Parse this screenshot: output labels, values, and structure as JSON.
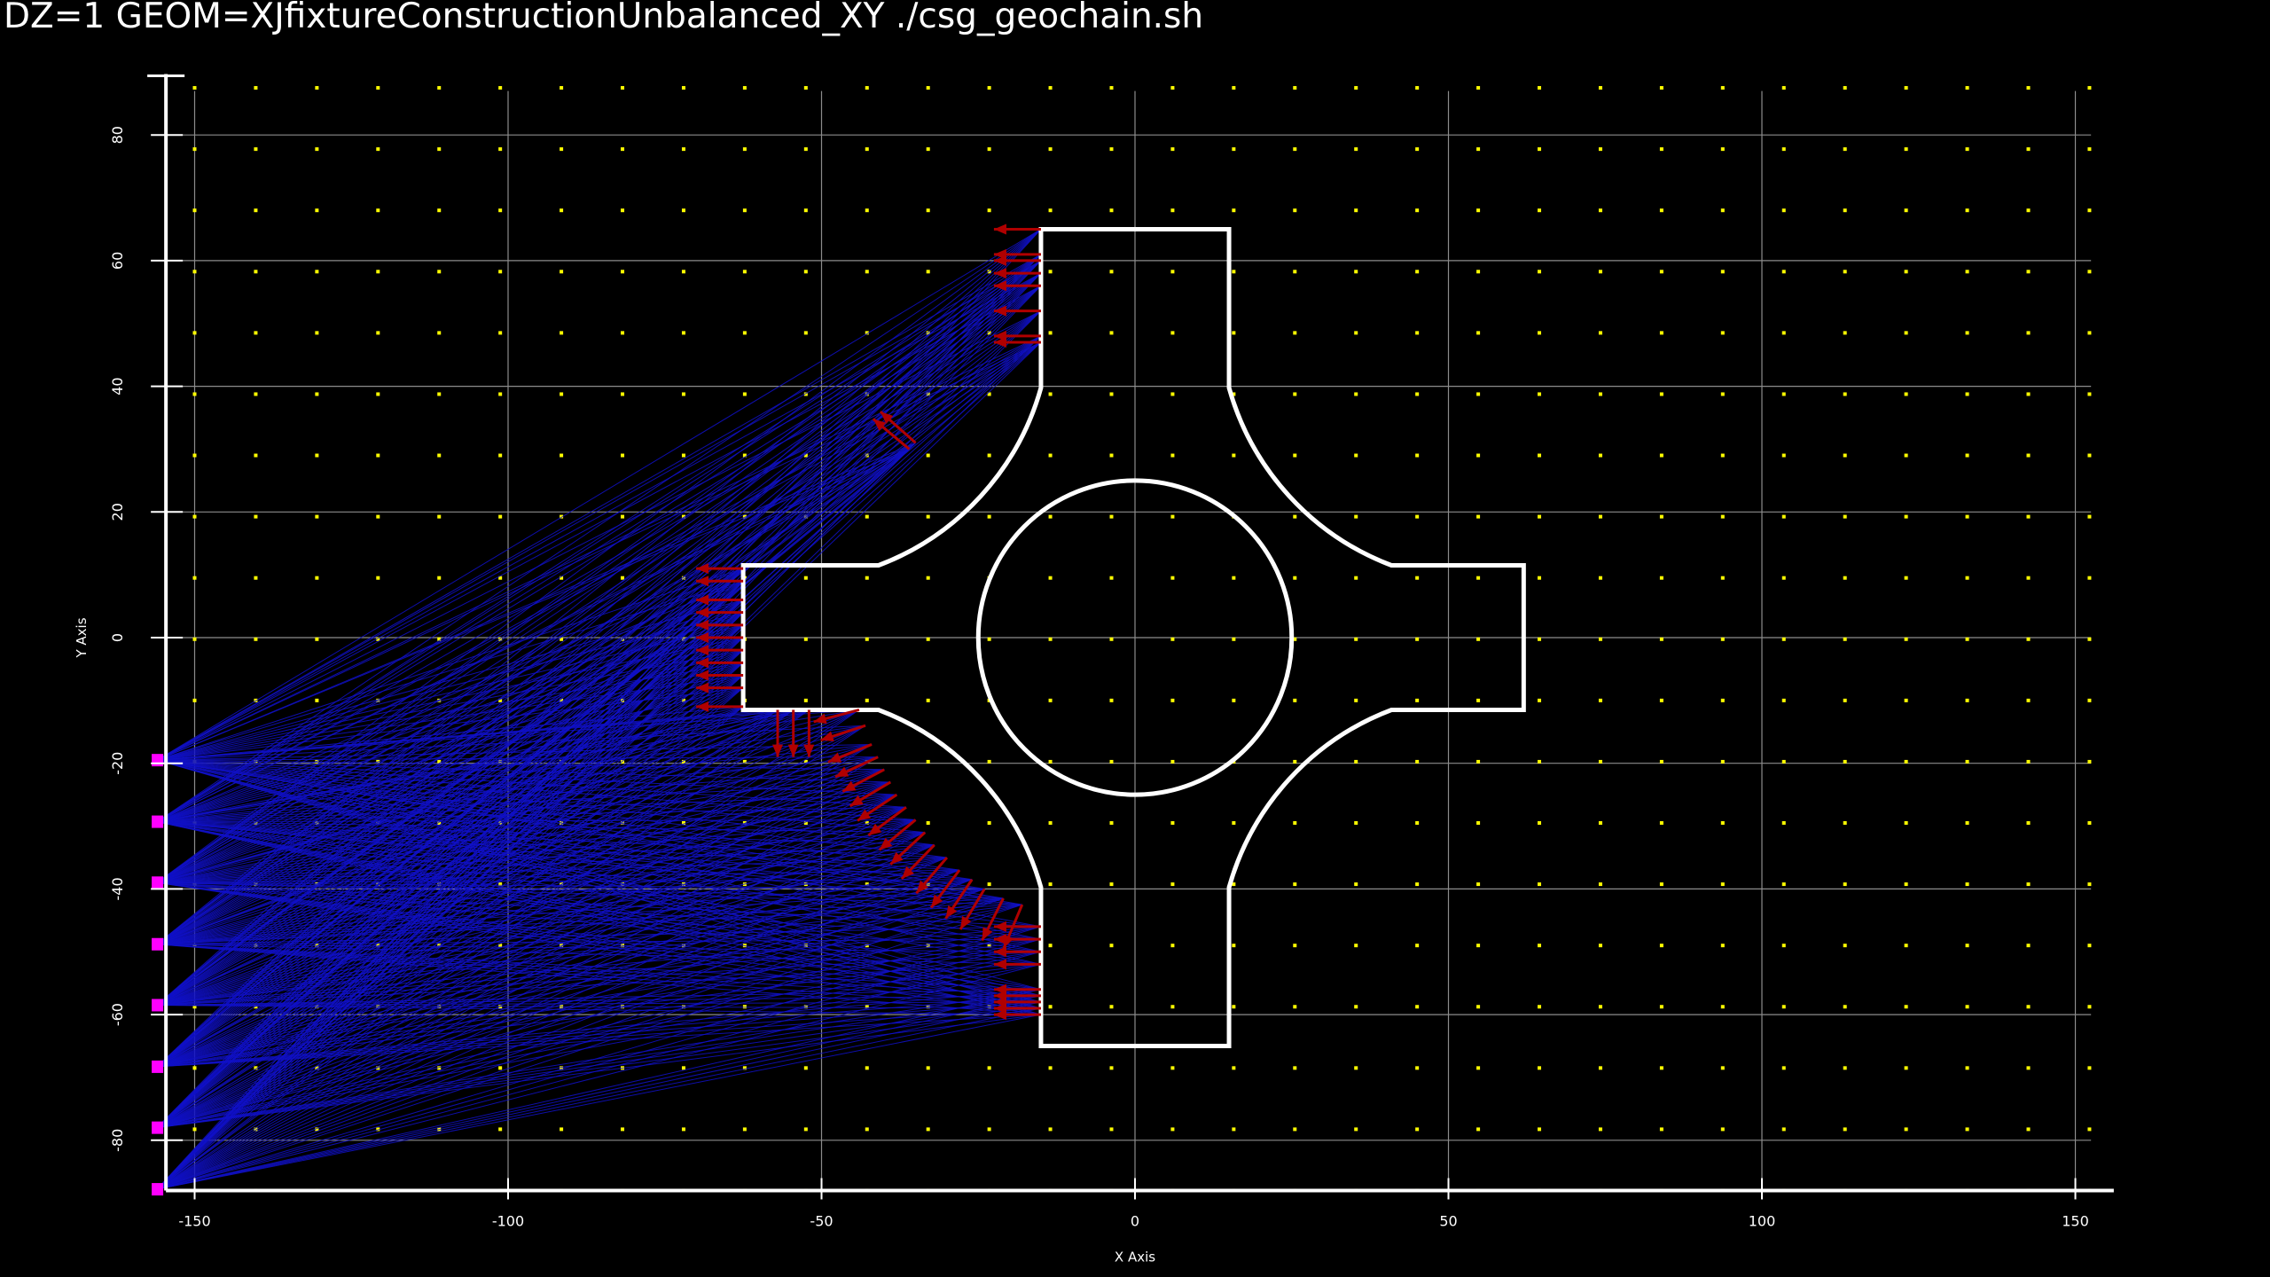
{
  "title": "DZ=1 GEOM=XJfixtureConstructionUnbalanced_XY ./csg_geochain.sh",
  "chart_data": {
    "type": "scatter",
    "title": "DZ=1 GEOM=XJfixtureConstructionUnbalanced_XY ./csg_geochain.sh",
    "xlabel": "X Axis",
    "ylabel": "Y Axis",
    "xlim": [
      -155,
      155
    ],
    "ylim": [
      -88,
      88
    ],
    "xticks": [
      -150,
      -100,
      -50,
      0,
      50,
      100,
      150
    ],
    "yticks": [
      -80,
      -60,
      -40,
      -20,
      0,
      20,
      40,
      60,
      80
    ],
    "grid": true,
    "colors": {
      "background": "#000000",
      "axes": "#ffffff",
      "grid": "#8c8c8c",
      "geometry": "#ffffff",
      "grid_points": "#ffff00",
      "rays": "#1010c8",
      "normals": "#b00000",
      "sources": "#ff00ff"
    },
    "geometry": {
      "outer_radius": 42.5,
      "inner_circle_radius": 25,
      "top_bar": {
        "x": [
          -15,
          15
        ],
        "y": [
          42.5,
          65
        ]
      },
      "bottom_bar": {
        "x": [
          -15,
          15
        ],
        "y": [
          -65,
          -42.5
        ]
      },
      "left_bar": {
        "x": [
          -62.5,
          -44
        ],
        "y": [
          -11.5,
          11.5
        ]
      },
      "right_bar": {
        "x": [
          44,
          62
        ],
        "y": [
          -11.5,
          11.5
        ]
      }
    },
    "grid_points": {
      "x_start": -150,
      "x_step": 9.75,
      "x_count": 32,
      "y_start": -88,
      "y_step": 9.75,
      "y_count": 19
    },
    "sources": {
      "x": -156,
      "y": [
        -19.5,
        -29.3,
        -39,
        -48.8,
        -58.5,
        -68.3,
        -78,
        -87.8
      ]
    },
    "hits": [
      {
        "x": -15,
        "y": 65
      },
      {
        "x": -15,
        "y": 61
      },
      {
        "x": -15,
        "y": 60
      },
      {
        "x": -15,
        "y": 58
      },
      {
        "x": -15,
        "y": 56
      },
      {
        "x": -15,
        "y": 52
      },
      {
        "x": -15,
        "y": 48
      },
      {
        "x": -15,
        "y": 47
      },
      {
        "x": -36,
        "y": 30
      },
      {
        "x": -35,
        "y": 31
      },
      {
        "x": -62.5,
        "y": 11
      },
      {
        "x": -62.5,
        "y": 9
      },
      {
        "x": -62.5,
        "y": 6
      },
      {
        "x": -62.5,
        "y": 4
      },
      {
        "x": -62.5,
        "y": 2
      },
      {
        "x": -62.5,
        "y": 0
      },
      {
        "x": -62.5,
        "y": -2
      },
      {
        "x": -62.5,
        "y": -4
      },
      {
        "x": -62.5,
        "y": -6
      },
      {
        "x": -62.5,
        "y": -8
      },
      {
        "x": -62.5,
        "y": -11
      },
      {
        "x": -57,
        "y": -11.5
      },
      {
        "x": -54.5,
        "y": -11.5
      },
      {
        "x": -52,
        "y": -11.5
      },
      {
        "x": -44,
        "y": -11.5
      },
      {
        "x": -43,
        "y": -14
      },
      {
        "x": -42,
        "y": -17
      },
      {
        "x": -41,
        "y": -19
      },
      {
        "x": -40,
        "y": -21
      },
      {
        "x": -39,
        "y": -23
      },
      {
        "x": -38,
        "y": -25
      },
      {
        "x": -36.5,
        "y": -27
      },
      {
        "x": -35,
        "y": -29
      },
      {
        "x": -33.5,
        "y": -31
      },
      {
        "x": -32,
        "y": -33
      },
      {
        "x": -30,
        "y": -35
      },
      {
        "x": -28,
        "y": -37
      },
      {
        "x": -26,
        "y": -38.5
      },
      {
        "x": -24,
        "y": -40
      },
      {
        "x": -21,
        "y": -41.5
      },
      {
        "x": -18,
        "y": -42.5
      },
      {
        "x": -15,
        "y": -46
      },
      {
        "x": -15,
        "y": -48
      },
      {
        "x": -15,
        "y": -50
      },
      {
        "x": -15,
        "y": -52
      },
      {
        "x": -15,
        "y": -56
      },
      {
        "x": -15,
        "y": -57
      },
      {
        "x": -15,
        "y": -58
      },
      {
        "x": -15,
        "y": -59
      },
      {
        "x": -15,
        "y": -60
      }
    ]
  }
}
